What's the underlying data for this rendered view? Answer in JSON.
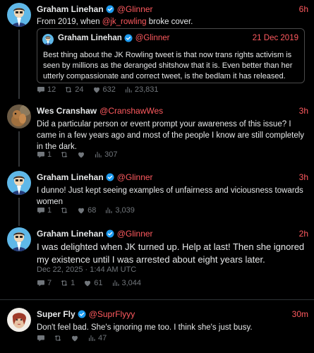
{
  "posts": [
    {
      "name": "Graham Linehan",
      "handle": "@Glinner",
      "time": "6h",
      "text_before": "From 2019, when ",
      "mention": "@jk_rowling",
      "text_after": " broke cover.",
      "quote": {
        "name": "Graham Linehan",
        "handle": "@Glinner",
        "date": "21 Dec 2019",
        "text": "Best thing about the JK Rowling tweet is that now trans rights activism is seen by millions as the deranged shitshow that it is. Even better than her utterly compassionate and correct tweet, is the bedlam it has released."
      },
      "replies": "12",
      "reposts": "24",
      "likes": "632",
      "views": "23,831"
    },
    {
      "name": "Wes Cranshaw",
      "handle": "@CranshawWes",
      "time": "3h",
      "text": "Did a particular person or event prompt your awareness of this issue? I came in a few years ago and most of the people I know are still completely in the dark.",
      "replies": "1",
      "views": "307"
    },
    {
      "name": "Graham Linehan",
      "handle": "@Glinner",
      "time": "3h",
      "text": "I dunno! Just kept seeing examples of unfairness and viciousness towards women",
      "replies": "1",
      "likes": "68",
      "views": "3,039"
    },
    {
      "name": "Graham Linehan",
      "handle": "@Glinner",
      "time": "2h",
      "text": "I was delighted when JK turned up. Help at last! Then she ignored my existence until I was arrested about eight years later.",
      "timestamp": "Dec 22, 2025 · 1:44 AM UTC",
      "replies": "7",
      "reposts": "1",
      "likes": "61",
      "views": "3,044"
    },
    {
      "name": "Super Fly",
      "handle": "@SuprFlyyy",
      "time": "30m",
      "text": "Don't feel bad. She's ignoring me too. I think she's just busy.",
      "views": "47"
    }
  ],
  "colors": {
    "accent": "#ff5a5f",
    "verified": "#1d9bf0",
    "muted": "#71767b",
    "background": "#000000"
  }
}
